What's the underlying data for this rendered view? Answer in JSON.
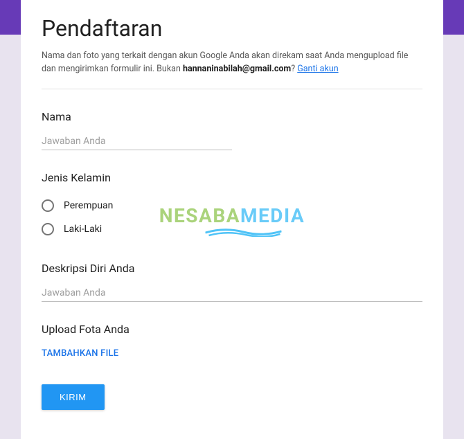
{
  "form": {
    "title": "Pendaftaran",
    "disclaimer_pre": "Nama dan foto yang terkait dengan akun Google Anda akan direkam saat Anda mengupload file dan mengirimkan formulir ini. Bukan ",
    "disclaimer_email": "hannaninabilah@gmail.com",
    "disclaimer_q": "? ",
    "switch_account": "Ganti akun"
  },
  "q_nama": {
    "label": "Nama",
    "placeholder": "Jawaban Anda"
  },
  "q_gender": {
    "label": "Jenis Kelamin",
    "options": [
      "Perempuan",
      "Laki-Laki"
    ]
  },
  "q_desc": {
    "label": "Deskripsi Diri Anda",
    "placeholder": "Jawaban Anda"
  },
  "q_upload": {
    "label": "Upload Fota Anda",
    "button": "TAMBAHKAN FILE"
  },
  "submit": "KIRIM",
  "watermark": {
    "p1": "NESABA",
    "p2": "MEDIA"
  }
}
